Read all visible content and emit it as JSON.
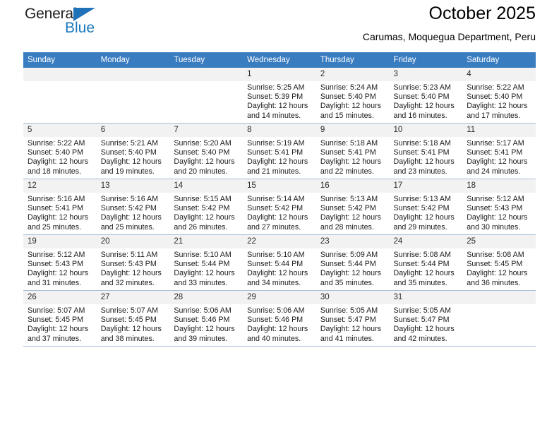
{
  "brand": {
    "name_part1": "General",
    "name_part2": "Blue",
    "triangle_color": "#1f71b8",
    "blue_color": "#1878be"
  },
  "header": {
    "title": "October 2025",
    "subtitle": "Carumas, Moquegua Department, Peru"
  },
  "theme": {
    "header_row_bg": "#3a7cc0",
    "header_row_text": "#ffffff",
    "daynum_bg": "#f2f2f2",
    "cell_border": "#a9bfd8"
  },
  "calendar": {
    "weekday_headers": [
      "Sunday",
      "Monday",
      "Tuesday",
      "Wednesday",
      "Thursday",
      "Friday",
      "Saturday"
    ],
    "labels": {
      "sunrise": "Sunrise:",
      "sunset": "Sunset:",
      "daylight": "Daylight:"
    },
    "weeks": [
      [
        {
          "day": "",
          "sunrise": "",
          "sunset": "",
          "daylight_line1": "",
          "daylight_line2": ""
        },
        {
          "day": "",
          "sunrise": "",
          "sunset": "",
          "daylight_line1": "",
          "daylight_line2": ""
        },
        {
          "day": "",
          "sunrise": "",
          "sunset": "",
          "daylight_line1": "",
          "daylight_line2": ""
        },
        {
          "day": "1",
          "sunrise": "Sunrise: 5:25 AM",
          "sunset": "Sunset: 5:39 PM",
          "daylight_line1": "Daylight: 12 hours",
          "daylight_line2": "and 14 minutes."
        },
        {
          "day": "2",
          "sunrise": "Sunrise: 5:24 AM",
          "sunset": "Sunset: 5:40 PM",
          "daylight_line1": "Daylight: 12 hours",
          "daylight_line2": "and 15 minutes."
        },
        {
          "day": "3",
          "sunrise": "Sunrise: 5:23 AM",
          "sunset": "Sunset: 5:40 PM",
          "daylight_line1": "Daylight: 12 hours",
          "daylight_line2": "and 16 minutes."
        },
        {
          "day": "4",
          "sunrise": "Sunrise: 5:22 AM",
          "sunset": "Sunset: 5:40 PM",
          "daylight_line1": "Daylight: 12 hours",
          "daylight_line2": "and 17 minutes."
        }
      ],
      [
        {
          "day": "5",
          "sunrise": "Sunrise: 5:22 AM",
          "sunset": "Sunset: 5:40 PM",
          "daylight_line1": "Daylight: 12 hours",
          "daylight_line2": "and 18 minutes."
        },
        {
          "day": "6",
          "sunrise": "Sunrise: 5:21 AM",
          "sunset": "Sunset: 5:40 PM",
          "daylight_line1": "Daylight: 12 hours",
          "daylight_line2": "and 19 minutes."
        },
        {
          "day": "7",
          "sunrise": "Sunrise: 5:20 AM",
          "sunset": "Sunset: 5:40 PM",
          "daylight_line1": "Daylight: 12 hours",
          "daylight_line2": "and 20 minutes."
        },
        {
          "day": "8",
          "sunrise": "Sunrise: 5:19 AM",
          "sunset": "Sunset: 5:41 PM",
          "daylight_line1": "Daylight: 12 hours",
          "daylight_line2": "and 21 minutes."
        },
        {
          "day": "9",
          "sunrise": "Sunrise: 5:18 AM",
          "sunset": "Sunset: 5:41 PM",
          "daylight_line1": "Daylight: 12 hours",
          "daylight_line2": "and 22 minutes."
        },
        {
          "day": "10",
          "sunrise": "Sunrise: 5:18 AM",
          "sunset": "Sunset: 5:41 PM",
          "daylight_line1": "Daylight: 12 hours",
          "daylight_line2": "and 23 minutes."
        },
        {
          "day": "11",
          "sunrise": "Sunrise: 5:17 AM",
          "sunset": "Sunset: 5:41 PM",
          "daylight_line1": "Daylight: 12 hours",
          "daylight_line2": "and 24 minutes."
        }
      ],
      [
        {
          "day": "12",
          "sunrise": "Sunrise: 5:16 AM",
          "sunset": "Sunset: 5:41 PM",
          "daylight_line1": "Daylight: 12 hours",
          "daylight_line2": "and 25 minutes."
        },
        {
          "day": "13",
          "sunrise": "Sunrise: 5:16 AM",
          "sunset": "Sunset: 5:42 PM",
          "daylight_line1": "Daylight: 12 hours",
          "daylight_line2": "and 25 minutes."
        },
        {
          "day": "14",
          "sunrise": "Sunrise: 5:15 AM",
          "sunset": "Sunset: 5:42 PM",
          "daylight_line1": "Daylight: 12 hours",
          "daylight_line2": "and 26 minutes."
        },
        {
          "day": "15",
          "sunrise": "Sunrise: 5:14 AM",
          "sunset": "Sunset: 5:42 PM",
          "daylight_line1": "Daylight: 12 hours",
          "daylight_line2": "and 27 minutes."
        },
        {
          "day": "16",
          "sunrise": "Sunrise: 5:13 AM",
          "sunset": "Sunset: 5:42 PM",
          "daylight_line1": "Daylight: 12 hours",
          "daylight_line2": "and 28 minutes."
        },
        {
          "day": "17",
          "sunrise": "Sunrise: 5:13 AM",
          "sunset": "Sunset: 5:42 PM",
          "daylight_line1": "Daylight: 12 hours",
          "daylight_line2": "and 29 minutes."
        },
        {
          "day": "18",
          "sunrise": "Sunrise: 5:12 AM",
          "sunset": "Sunset: 5:43 PM",
          "daylight_line1": "Daylight: 12 hours",
          "daylight_line2": "and 30 minutes."
        }
      ],
      [
        {
          "day": "19",
          "sunrise": "Sunrise: 5:12 AM",
          "sunset": "Sunset: 5:43 PM",
          "daylight_line1": "Daylight: 12 hours",
          "daylight_line2": "and 31 minutes."
        },
        {
          "day": "20",
          "sunrise": "Sunrise: 5:11 AM",
          "sunset": "Sunset: 5:43 PM",
          "daylight_line1": "Daylight: 12 hours",
          "daylight_line2": "and 32 minutes."
        },
        {
          "day": "21",
          "sunrise": "Sunrise: 5:10 AM",
          "sunset": "Sunset: 5:44 PM",
          "daylight_line1": "Daylight: 12 hours",
          "daylight_line2": "and 33 minutes."
        },
        {
          "day": "22",
          "sunrise": "Sunrise: 5:10 AM",
          "sunset": "Sunset: 5:44 PM",
          "daylight_line1": "Daylight: 12 hours",
          "daylight_line2": "and 34 minutes."
        },
        {
          "day": "23",
          "sunrise": "Sunrise: 5:09 AM",
          "sunset": "Sunset: 5:44 PM",
          "daylight_line1": "Daylight: 12 hours",
          "daylight_line2": "and 35 minutes."
        },
        {
          "day": "24",
          "sunrise": "Sunrise: 5:08 AM",
          "sunset": "Sunset: 5:44 PM",
          "daylight_line1": "Daylight: 12 hours",
          "daylight_line2": "and 35 minutes."
        },
        {
          "day": "25",
          "sunrise": "Sunrise: 5:08 AM",
          "sunset": "Sunset: 5:45 PM",
          "daylight_line1": "Daylight: 12 hours",
          "daylight_line2": "and 36 minutes."
        }
      ],
      [
        {
          "day": "26",
          "sunrise": "Sunrise: 5:07 AM",
          "sunset": "Sunset: 5:45 PM",
          "daylight_line1": "Daylight: 12 hours",
          "daylight_line2": "and 37 minutes."
        },
        {
          "day": "27",
          "sunrise": "Sunrise: 5:07 AM",
          "sunset": "Sunset: 5:45 PM",
          "daylight_line1": "Daylight: 12 hours",
          "daylight_line2": "and 38 minutes."
        },
        {
          "day": "28",
          "sunrise": "Sunrise: 5:06 AM",
          "sunset": "Sunset: 5:46 PM",
          "daylight_line1": "Daylight: 12 hours",
          "daylight_line2": "and 39 minutes."
        },
        {
          "day": "29",
          "sunrise": "Sunrise: 5:06 AM",
          "sunset": "Sunset: 5:46 PM",
          "daylight_line1": "Daylight: 12 hours",
          "daylight_line2": "and 40 minutes."
        },
        {
          "day": "30",
          "sunrise": "Sunrise: 5:05 AM",
          "sunset": "Sunset: 5:47 PM",
          "daylight_line1": "Daylight: 12 hours",
          "daylight_line2": "and 41 minutes."
        },
        {
          "day": "31",
          "sunrise": "Sunrise: 5:05 AM",
          "sunset": "Sunset: 5:47 PM",
          "daylight_line1": "Daylight: 12 hours",
          "daylight_line2": "and 42 minutes."
        },
        {
          "day": "",
          "sunrise": "",
          "sunset": "",
          "daylight_line1": "",
          "daylight_line2": ""
        }
      ]
    ]
  }
}
